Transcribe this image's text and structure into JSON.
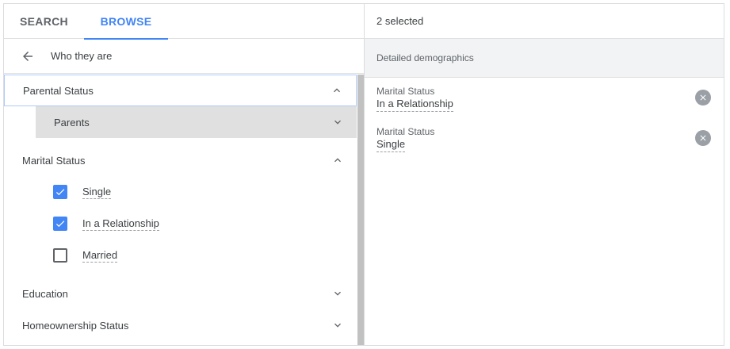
{
  "tabs": {
    "search": "SEARCH",
    "browse": "BROWSE"
  },
  "crumb": {
    "label": "Who they are",
    "icon": "arrow-back-icon"
  },
  "parental": {
    "label": "Parental Status",
    "sub_label": "Parents"
  },
  "marital": {
    "label": "Marital Status",
    "options": [
      {
        "label": "Single",
        "checked": true
      },
      {
        "label": "In a Relationship",
        "checked": true
      },
      {
        "label": "Married",
        "checked": false
      }
    ]
  },
  "education": {
    "label": "Education"
  },
  "homeownership": {
    "label": "Homeownership Status"
  },
  "selection": {
    "count_label": "2 selected",
    "section_label": "Detailed demographics",
    "items": [
      {
        "category": "Marital Status",
        "value": "In a Relationship"
      },
      {
        "category": "Marital Status",
        "value": "Single"
      }
    ]
  },
  "colors": {
    "accent": "#4285f4",
    "focus_border": "#aecbfa",
    "sub_row_bg": "#e0e0e0",
    "section_bg": "#f1f3f4",
    "remove_icon": "#9aa0a6"
  }
}
